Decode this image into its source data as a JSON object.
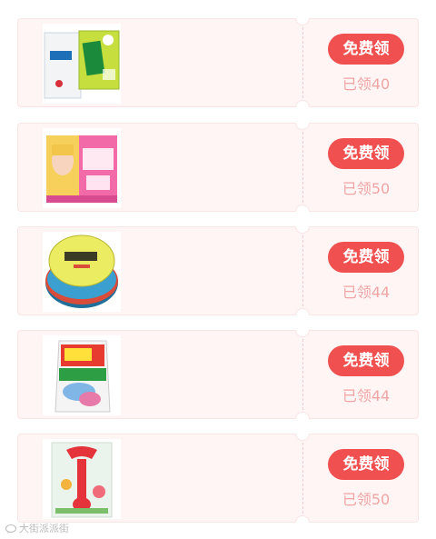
{
  "coupons": [
    {
      "product_icon": "dettol-soap-icon",
      "button_label": "免费领",
      "claimed_label": "已领40"
    },
    {
      "product_icon": "pink-pad-box-icon",
      "button_label": "免费领",
      "claimed_label": "已领50"
    },
    {
      "product_icon": "round-tin-cream-icon",
      "button_label": "免费领",
      "claimed_label": "已领44"
    },
    {
      "product_icon": "laundry-pouch-icon",
      "button_label": "免费领",
      "claimed_label": "已领44"
    },
    {
      "product_icon": "red-peeler-icon",
      "button_label": "免费领",
      "claimed_label": "已领50"
    }
  ],
  "watermark": {
    "text": "大街派派街"
  },
  "colors": {
    "button": "#f0504f",
    "claimed_text": "#f1a4a4",
    "card_bg": "#fff5f5"
  }
}
